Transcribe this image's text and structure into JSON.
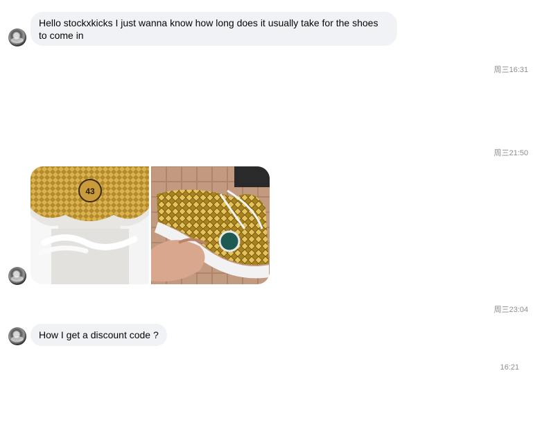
{
  "messages": [
    {
      "type": "text",
      "text": "Hello stockxkicks I just wanna know how long does it usually take for the shoes to come in"
    },
    {
      "type": "timestamp",
      "text": "周三16:31"
    },
    {
      "type": "timestamp",
      "text": "周三21:50"
    },
    {
      "type": "photos",
      "photos": [
        {
          "subject": "shoe-interior-size-tag-photo",
          "size_tag": "43"
        },
        {
          "subject": "gold-sneaker-photo"
        }
      ]
    },
    {
      "type": "timestamp",
      "text": "周三23:04"
    },
    {
      "type": "text",
      "text": "How I get a discount code ?"
    },
    {
      "type": "timestamp",
      "text": "16:21"
    }
  ],
  "colors": {
    "bubble_bg": "#f0f2f5",
    "timestamp": "#8a8d91",
    "text": "#050505"
  }
}
